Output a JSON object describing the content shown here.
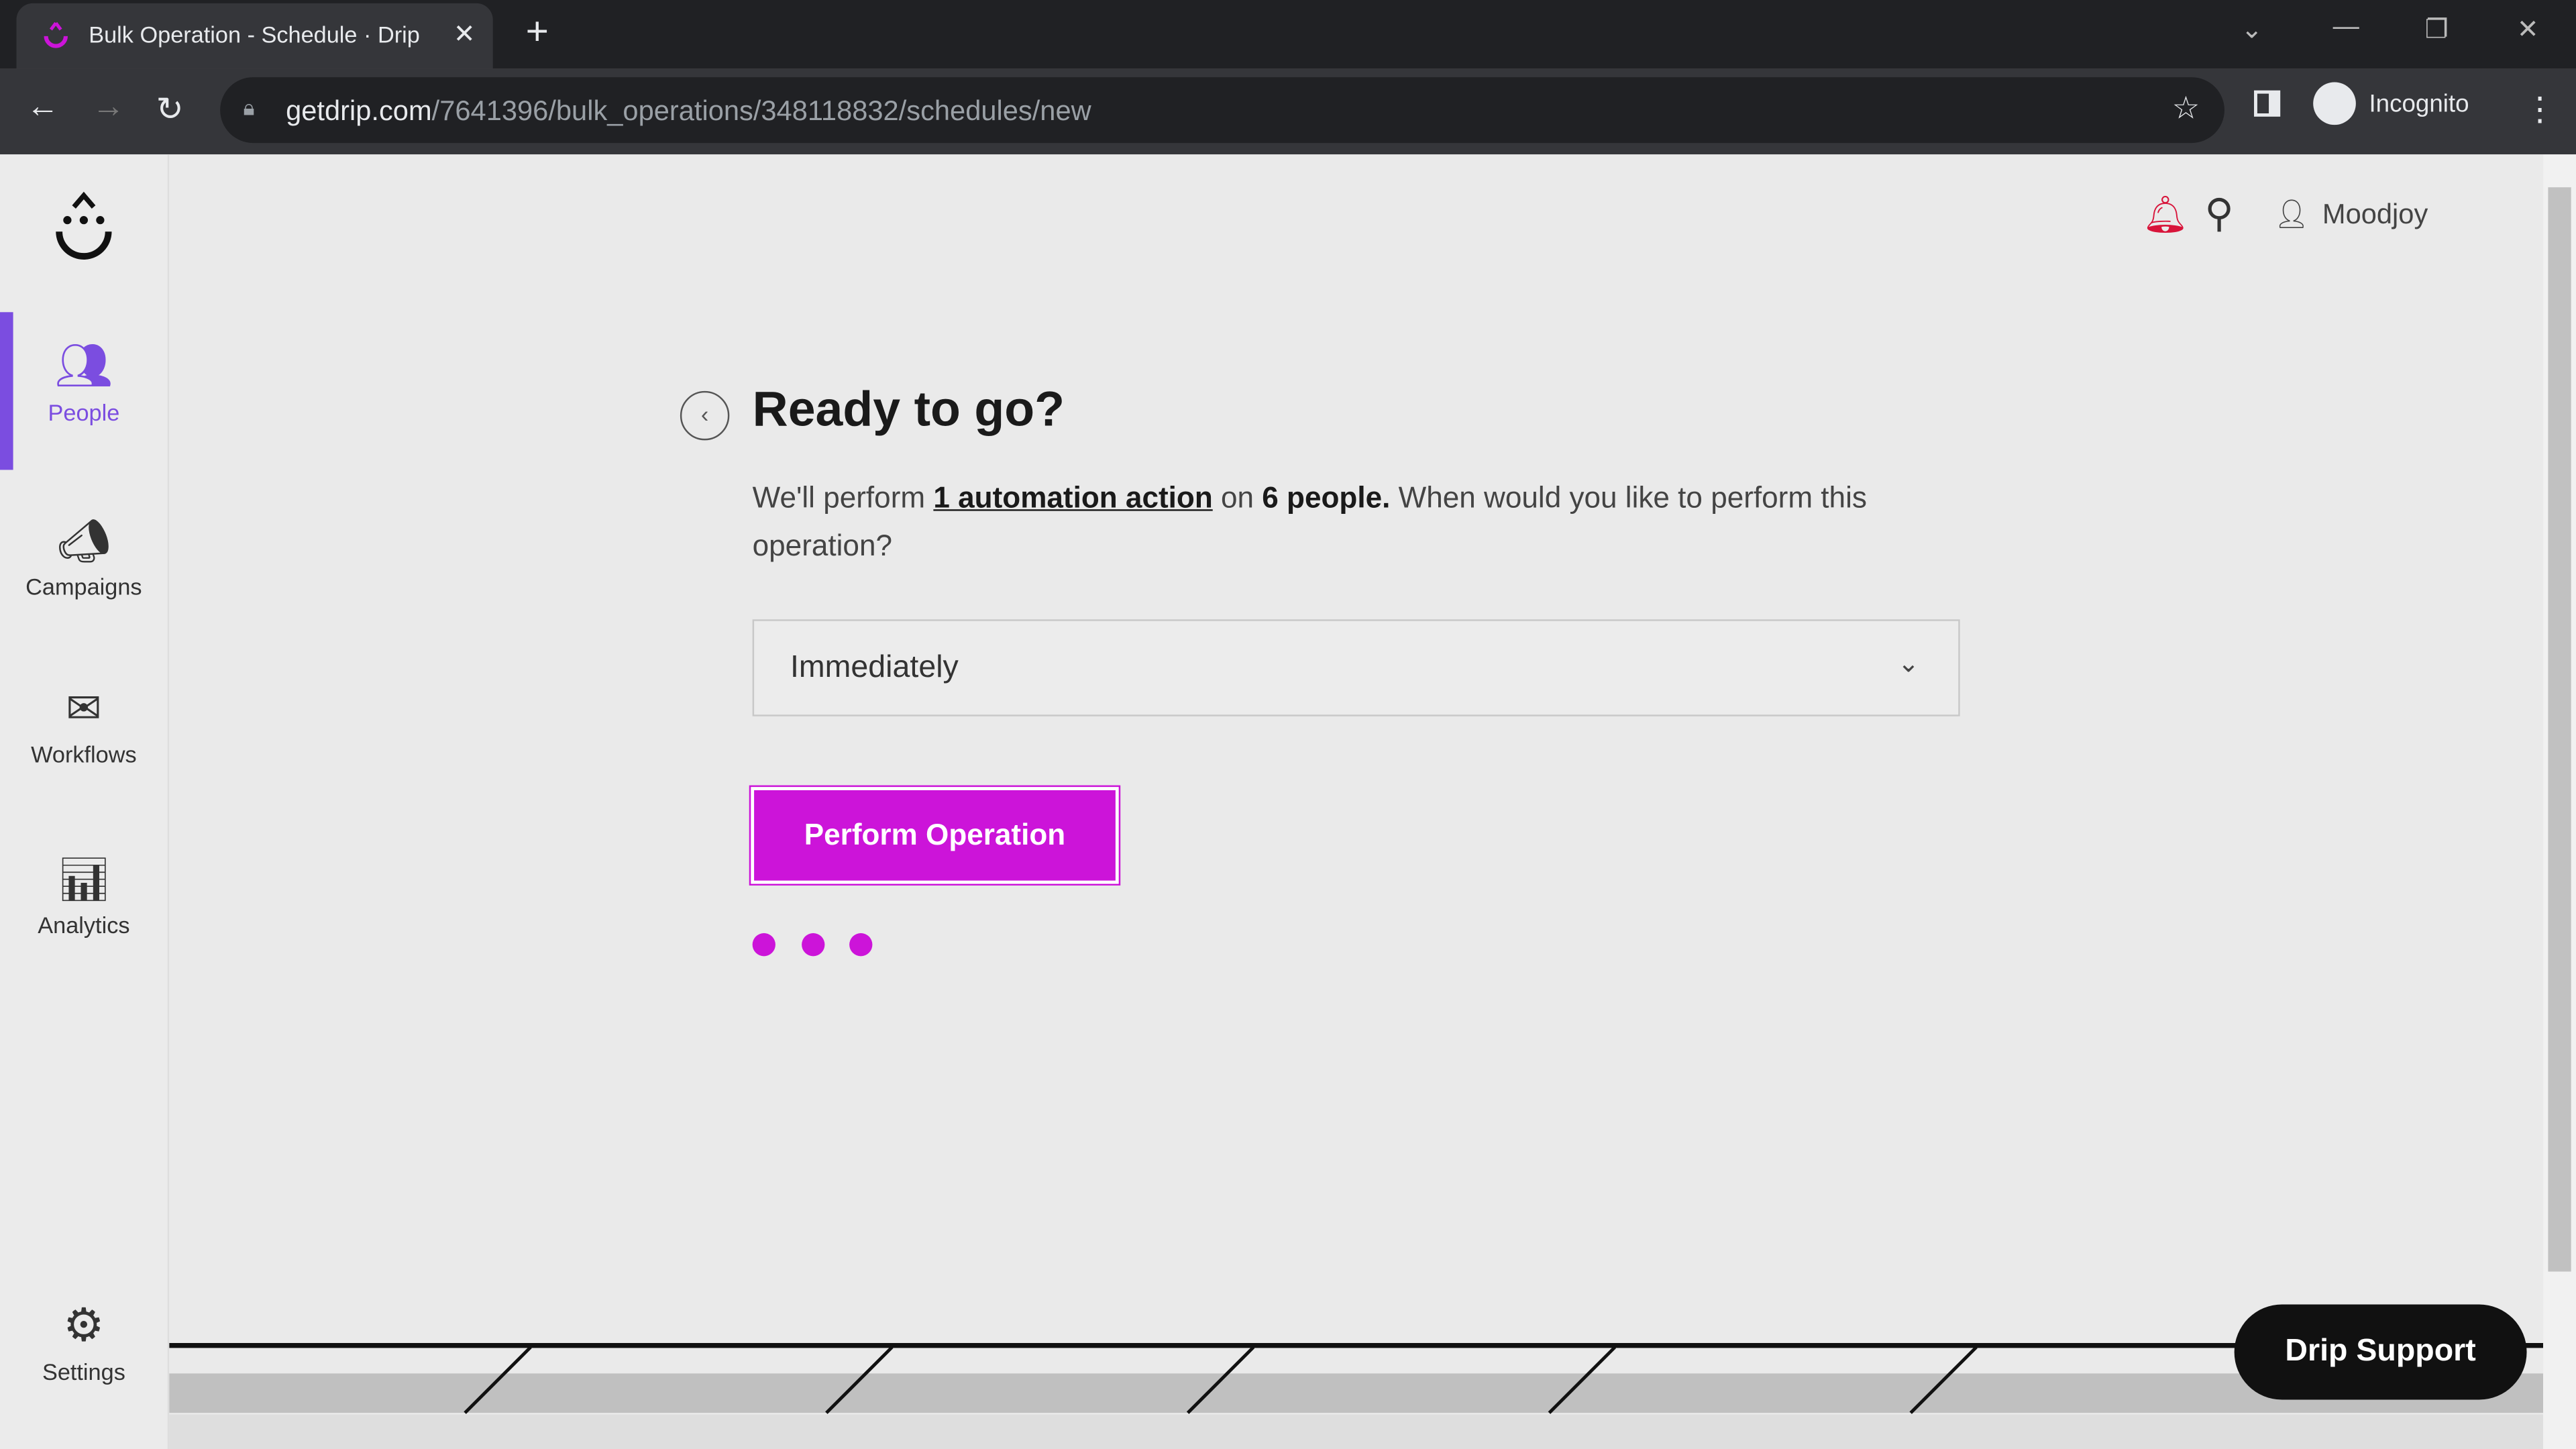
{
  "browser": {
    "tab_title": "Bulk Operation - Schedule · Drip",
    "url_host": "getdrip.com",
    "url_path": "/7641396/bulk_operations/348118832/schedules/new",
    "profile": "Incognito"
  },
  "sidebar": {
    "items": [
      {
        "label": "People",
        "active": true
      },
      {
        "label": "Campaigns"
      },
      {
        "label": "Workflows"
      },
      {
        "label": "Analytics"
      },
      {
        "label": "Settings"
      }
    ]
  },
  "header": {
    "user": "Moodjoy"
  },
  "main": {
    "title": "Ready to go?",
    "desc_pre": "We'll perform ",
    "desc_link": "1 automation action",
    "desc_mid": " on ",
    "desc_bold": "6 people.",
    "desc_post": " When would you like to perform this operation?",
    "schedule_value": "Immediately",
    "perform_button": "Perform Operation"
  },
  "support": {
    "label": "Drip Support"
  },
  "colors": {
    "accent": "#cc14d9",
    "active_nav": "#7b4de0"
  }
}
